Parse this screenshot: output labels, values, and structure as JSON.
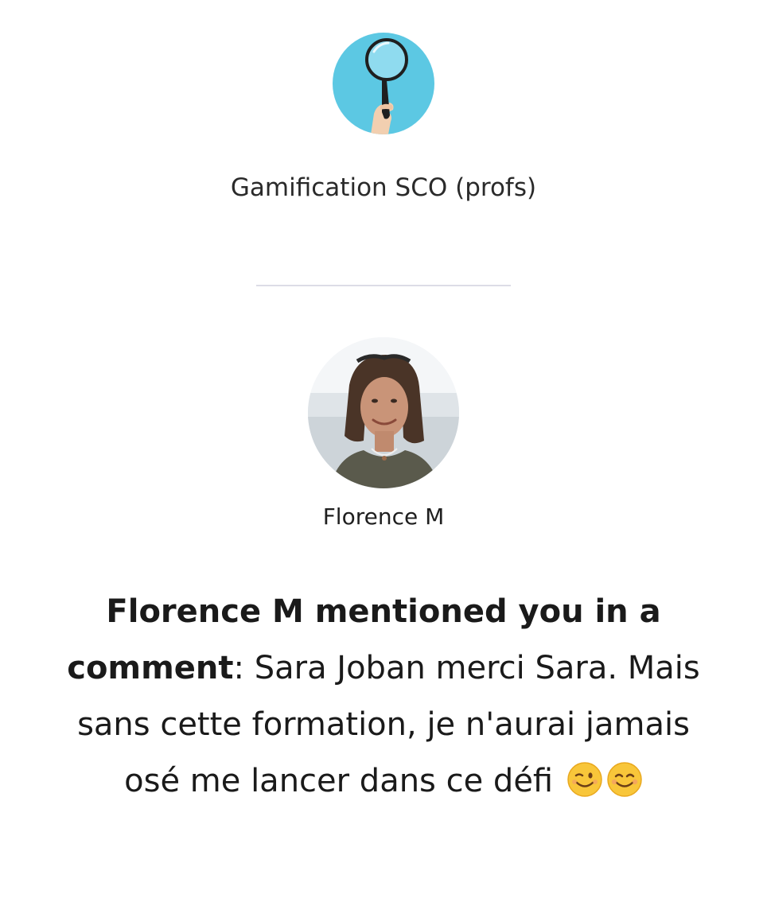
{
  "group": {
    "name": "Gamification SCO (profs)",
    "avatar_icon": "magnifying-glass-icon",
    "avatar_color": "#5cc8e3"
  },
  "user": {
    "name": "Florence M",
    "avatar": "profile-photo"
  },
  "notification": {
    "bold_text": "Florence M mentioned you in a comment",
    "separator": ":",
    "comment": " Sara Joban merci Sara. Mais sans cette formation, je n'aurai jamais osé me lancer dans ce défi",
    "emojis": [
      "winking-face-icon",
      "smiling-face-icon"
    ]
  }
}
